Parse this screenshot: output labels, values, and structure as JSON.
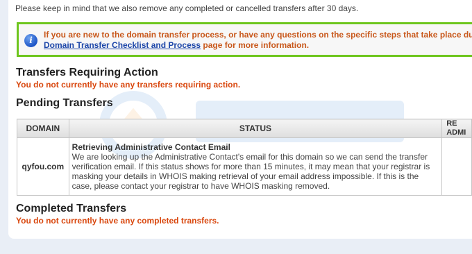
{
  "notice": {
    "text": "Please keep in mind that we also remove any completed or cancelled transfers after 30 days."
  },
  "infobox": {
    "line1": "If you are new to the domain transfer process, or have any questions on the specific steps that take place du",
    "link": "Domain Transfer Checklist and Process",
    "line2_suffix": " page for more information.",
    "icon": "info-icon",
    "border_color": "#6ec61e"
  },
  "requiring_action": {
    "heading": "Transfers Requiring Action",
    "message": "You do not currently have any transfers requiring action."
  },
  "pending": {
    "heading": "Pending Transfers",
    "columns": {
      "domain": "DOMAIN",
      "status": "STATUS",
      "req_line1": "RE",
      "req_line2": "ADMI"
    },
    "rows": [
      {
        "domain": "qyfou.com",
        "status_title": "Retrieving Administrative Contact Email",
        "status_body": "We are looking up the Administrative Contact's email for this domain so we can send the transfer verification email. If this status shows for more than 15 minutes, it may mean that your registrar is masking your details in WHOIS making retrieval of your email address impossible. If this is the case, please contact your registrar to have WHOIS masking removed."
      }
    ]
  },
  "completed": {
    "heading": "Completed Transfers",
    "message": "You do not currently have any completed transfers."
  },
  "colors": {
    "warning_text": "#d9480f",
    "link": "#1b45a8"
  }
}
